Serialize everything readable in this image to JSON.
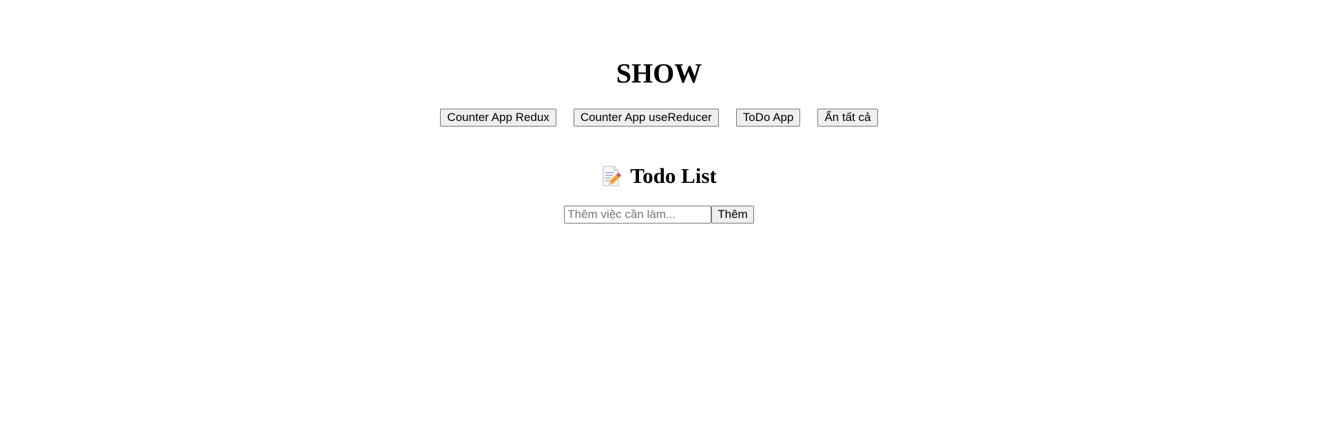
{
  "header": {
    "title": "SHOW"
  },
  "nav": {
    "buttons": [
      {
        "label": "Counter App Redux"
      },
      {
        "label": "Counter App useReducer"
      },
      {
        "label": "ToDo App"
      },
      {
        "label": "Ẩn tất cả"
      }
    ]
  },
  "todo": {
    "icon": "memo-icon",
    "title": "Todo List",
    "input": {
      "value": "",
      "placeholder": "Thêm việc cần làm..."
    },
    "add_label": "Thêm"
  }
}
